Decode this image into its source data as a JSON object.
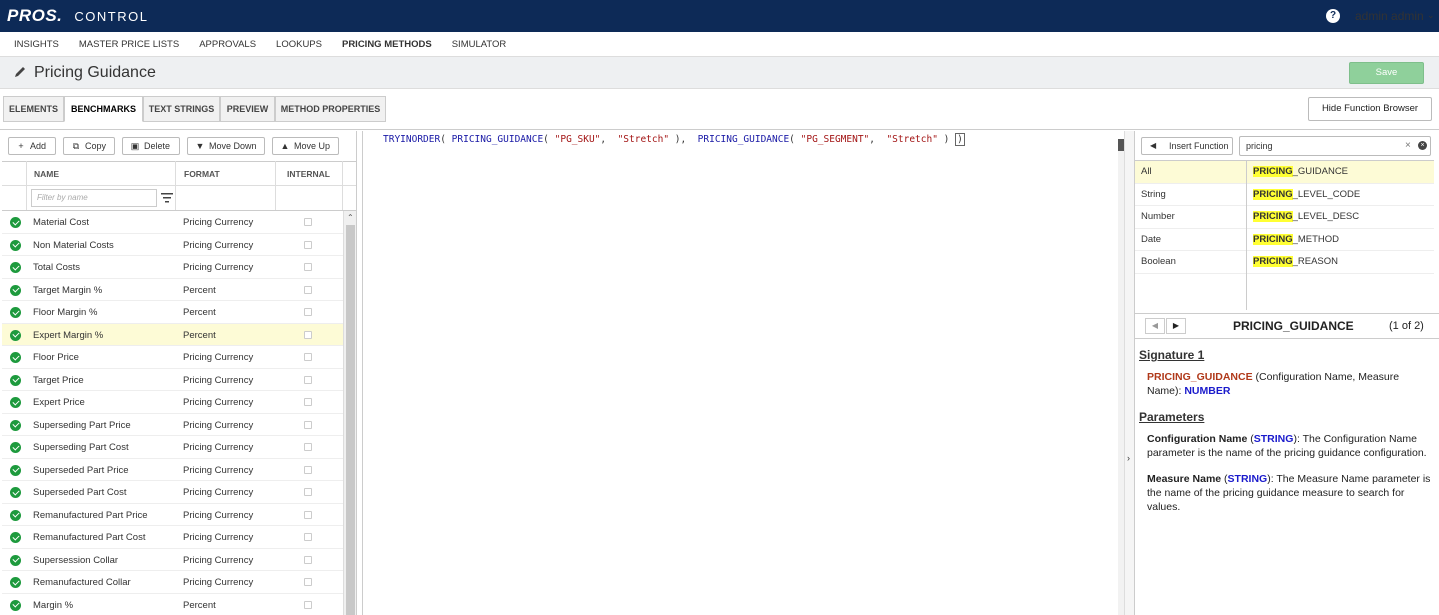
{
  "header": {
    "logo": "PROS.",
    "app_name": "CONTROL",
    "help": "?",
    "user": "admin admin"
  },
  "nav": [
    "INSIGHTS",
    "MASTER PRICE LISTS",
    "APPROVALS",
    "LOOKUPS",
    "PRICING METHODS",
    "SIMULATOR"
  ],
  "nav_active": "PRICING METHODS",
  "page": {
    "title": "Pricing Guidance",
    "save_label": "Save"
  },
  "tabs": [
    "ELEMENTS",
    "BENCHMARKS",
    "TEXT STRINGS",
    "PREVIEW",
    "METHOD PROPERTIES"
  ],
  "active_tab": "BENCHMARKS",
  "hide_function_browser": "Hide Function Browser",
  "toolbar": {
    "add": "Add",
    "copy": "Copy",
    "delete": "Delete",
    "move_down": "Move Down",
    "move_up": "Move Up"
  },
  "grid": {
    "columns": {
      "name": "NAME",
      "format": "FORMAT",
      "internal": "INTERNAL"
    },
    "filter_placeholder": "Filter by name",
    "rows": [
      {
        "name": "Material Cost",
        "format": "Pricing Currency"
      },
      {
        "name": "Non Material Costs",
        "format": "Pricing Currency"
      },
      {
        "name": "Total Costs",
        "format": "Pricing Currency"
      },
      {
        "name": "Target Margin %",
        "format": "Percent"
      },
      {
        "name": "Floor Margin %",
        "format": "Percent"
      },
      {
        "name": "Expert Margin %",
        "format": "Percent"
      },
      {
        "name": "Floor Price",
        "format": "Pricing Currency"
      },
      {
        "name": "Target Price",
        "format": "Pricing Currency"
      },
      {
        "name": "Expert Price",
        "format": "Pricing Currency"
      },
      {
        "name": "Superseding Part Price",
        "format": "Pricing Currency"
      },
      {
        "name": "Superseding Part Cost",
        "format": "Pricing Currency"
      },
      {
        "name": "Superseded Part Price",
        "format": "Pricing Currency"
      },
      {
        "name": "Superseded Part Cost",
        "format": "Pricing Currency"
      },
      {
        "name": "Remanufactured Part Price",
        "format": "Pricing Currency"
      },
      {
        "name": "Remanufactured Part Cost",
        "format": "Pricing Currency"
      },
      {
        "name": "Supersession Collar",
        "format": "Pricing Currency"
      },
      {
        "name": "Remanufactured Collar",
        "format": "Pricing Currency"
      },
      {
        "name": "Margin %",
        "format": "Percent"
      }
    ],
    "selected_row": "Expert Margin %"
  },
  "editor": {
    "fn_outer": "TRYINORDER",
    "fn_inner": "PRICING_GUIDANCE",
    "arg1a": "\"PG_SKU\"",
    "arg1b": "\"Stretch\"",
    "arg2a": "\"PG_SEGMENT\"",
    "arg2b": "\"Stretch\""
  },
  "function_browser": {
    "insert_label": "Insert Function",
    "search_value": "pricing",
    "categories": [
      "All",
      "String",
      "Number",
      "Date",
      "Boolean"
    ],
    "selected_category": "All",
    "highlight": "PRICING",
    "functions": [
      "_GUIDANCE",
      "_LEVEL_CODE",
      "_LEVEL_DESC",
      "_METHOD",
      "_REASON"
    ],
    "detail_title": "PRICING_GUIDANCE",
    "detail_count": "(1 of 2)",
    "signature_heading": "Signature 1",
    "sig_fn": "PRICING_GUIDANCE",
    "sig_args": " (Configuration Name, Measure Name): ",
    "sig_return": "NUMBER",
    "parameters_heading": "Parameters",
    "p1_name": "Configuration Name",
    "p1_type": "STRING",
    "p1_desc": ": The Configuration Name parameter is the name of the pricing guidance configuration.",
    "p2_name": "Measure Name",
    "p2_type": "STRING",
    "p2_desc": ": The Measure Name parameter is the name of the pricing guidance measure to search for values."
  },
  "colors": {
    "header_bg": "#0d2a57",
    "save_bg": "#8fd09b",
    "ok_green": "#1d9a3d",
    "selected_row": "#fdfbd6",
    "highlight": "#ffff33"
  }
}
